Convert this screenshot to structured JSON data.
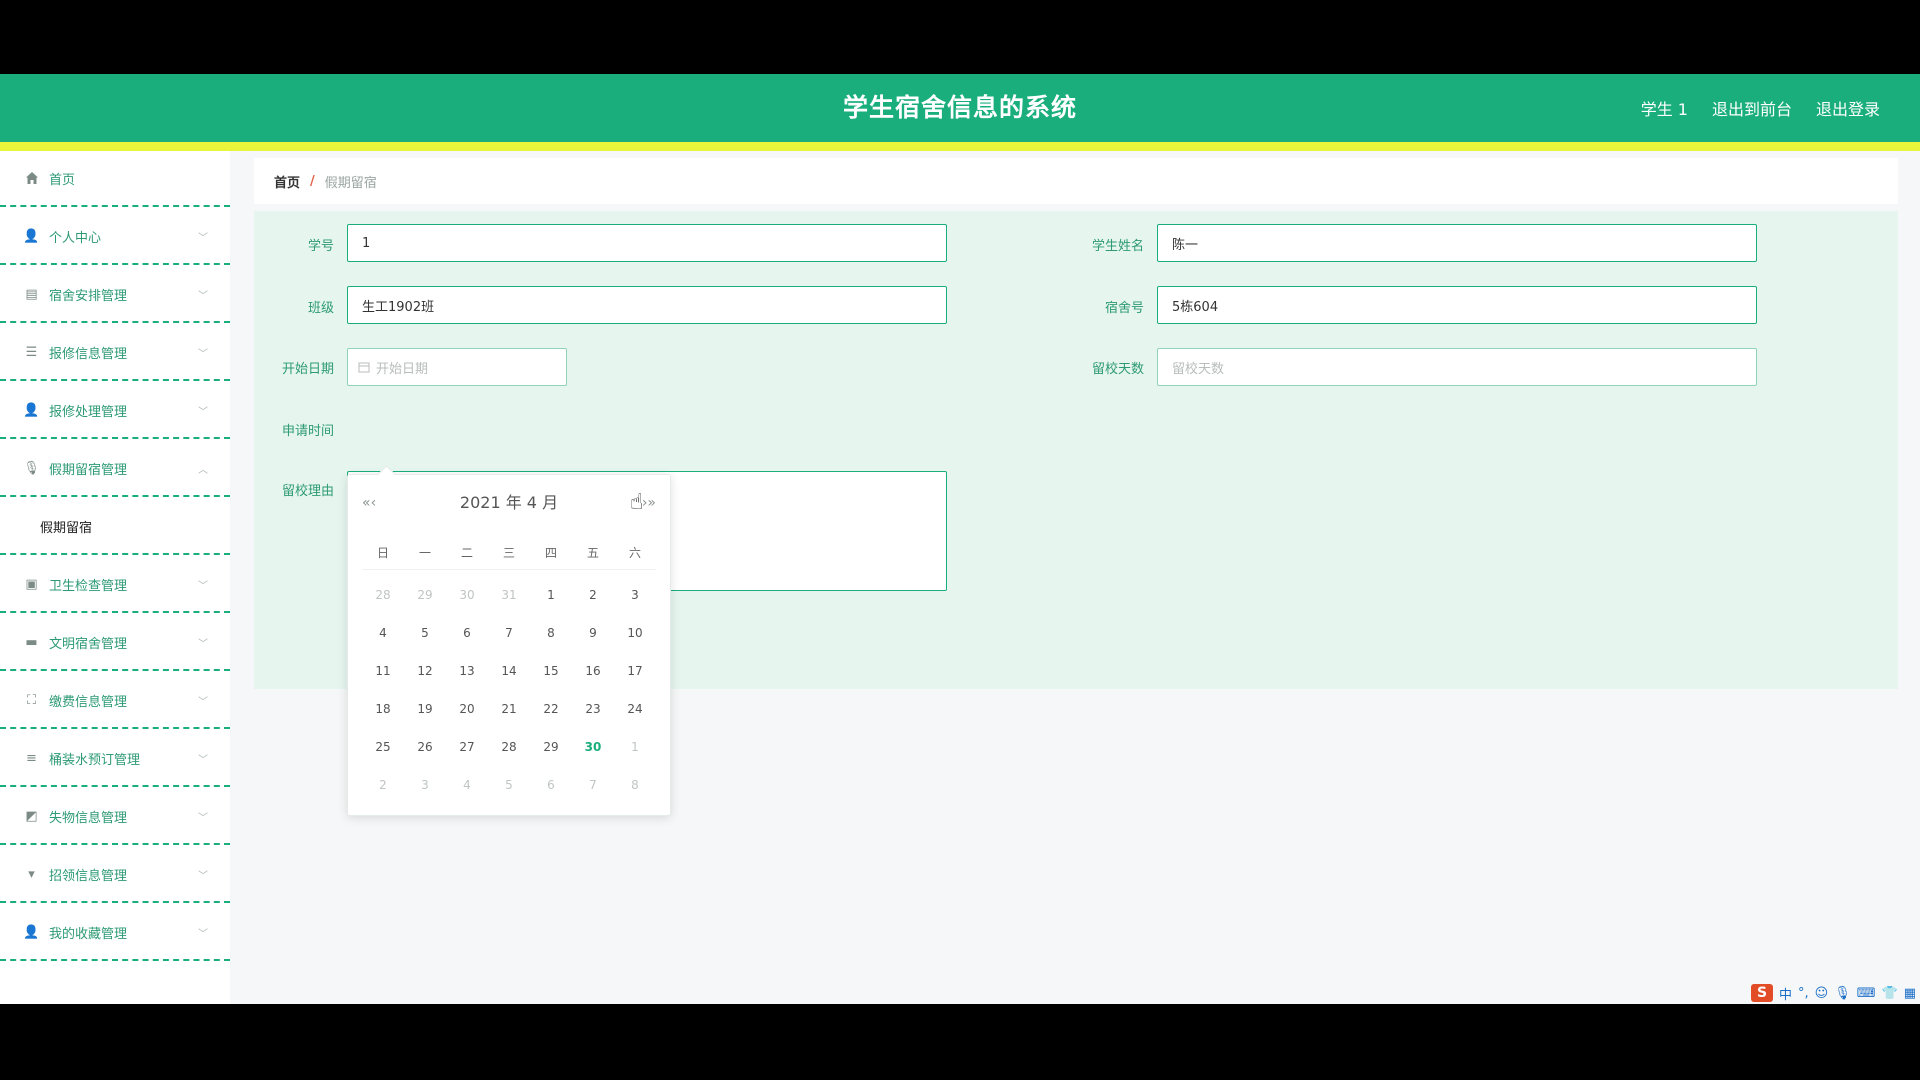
{
  "header": {
    "title": "学生宿舍信息的系统",
    "user": "学生 1",
    "back_to_front": "退出到前台",
    "logout": "退出登录",
    "colors": {
      "primary": "#1aae7d",
      "accent_bar": "#e8f53a"
    }
  },
  "sidebar": {
    "home": "首页",
    "items": [
      {
        "label": "个人中心",
        "icon": "user-icon"
      },
      {
        "label": "宿舍安排管理",
        "icon": "clipboard-icon"
      },
      {
        "label": "报修信息管理",
        "icon": "sliders-icon"
      },
      {
        "label": "报修处理管理",
        "icon": "user-icon"
      },
      {
        "label": "假期留宿管理",
        "icon": "microphone-icon",
        "expanded": true,
        "sub": "假期留宿"
      },
      {
        "label": "卫生检查管理",
        "icon": "briefcase-icon"
      },
      {
        "label": "文明宿舍管理",
        "icon": "monitor-icon"
      },
      {
        "label": "缴费信息管理",
        "icon": "fullscreen-icon"
      },
      {
        "label": "桶装水预订管理",
        "icon": "list-icon"
      },
      {
        "label": "失物信息管理",
        "icon": "chart-icon"
      },
      {
        "label": "招领信息管理",
        "icon": "sign-icon"
      },
      {
        "label": "我的收藏管理",
        "icon": "user-icon"
      }
    ]
  },
  "breadcrumb": {
    "home": "首页",
    "sep": "/",
    "current": "假期留宿"
  },
  "form": {
    "student_no_label": "学号",
    "student_no_value": "1",
    "student_name_label": "学生姓名",
    "student_name_value": "陈一",
    "class_label": "班级",
    "class_value": "生工1902班",
    "dorm_label": "宿舍号",
    "dorm_value": "5栋604",
    "start_date_label": "开始日期",
    "start_date_placeholder": "开始日期",
    "stay_days_label": "留校天数",
    "stay_days_placeholder": "留校天数",
    "apply_time_label": "申请时间",
    "reason_label": "留校理由"
  },
  "datepicker": {
    "prev": "«‹",
    "next": "›»",
    "header": "2021 年  4 月",
    "weekdays": [
      "日",
      "一",
      "二",
      "三",
      "四",
      "五",
      "六"
    ],
    "weeks": [
      [
        {
          "d": "28",
          "o": 1
        },
        {
          "d": "29",
          "o": 1
        },
        {
          "d": "30",
          "o": 1
        },
        {
          "d": "31",
          "o": 1
        },
        {
          "d": "1"
        },
        {
          "d": "2"
        },
        {
          "d": "3"
        }
      ],
      [
        {
          "d": "4"
        },
        {
          "d": "5"
        },
        {
          "d": "6"
        },
        {
          "d": "7"
        },
        {
          "d": "8"
        },
        {
          "d": "9"
        },
        {
          "d": "10"
        }
      ],
      [
        {
          "d": "11"
        },
        {
          "d": "12"
        },
        {
          "d": "13"
        },
        {
          "d": "14"
        },
        {
          "d": "15"
        },
        {
          "d": "16"
        },
        {
          "d": "17"
        }
      ],
      [
        {
          "d": "18"
        },
        {
          "d": "19"
        },
        {
          "d": "20"
        },
        {
          "d": "21"
        },
        {
          "d": "22"
        },
        {
          "d": "23"
        },
        {
          "d": "24"
        }
      ],
      [
        {
          "d": "25"
        },
        {
          "d": "26"
        },
        {
          "d": "27"
        },
        {
          "d": "28"
        },
        {
          "d": "29"
        },
        {
          "d": "30",
          "t": 1
        },
        {
          "d": "1",
          "o": 1
        }
      ],
      [
        {
          "d": "2",
          "o": 1
        },
        {
          "d": "3",
          "o": 1
        },
        {
          "d": "4",
          "o": 1
        },
        {
          "d": "5",
          "o": 1
        },
        {
          "d": "6",
          "o": 1
        },
        {
          "d": "7",
          "o": 1
        },
        {
          "d": "8",
          "o": 1
        }
      ]
    ]
  },
  "tray": {
    "ime_logo": "S",
    "ime_lang": "中"
  }
}
